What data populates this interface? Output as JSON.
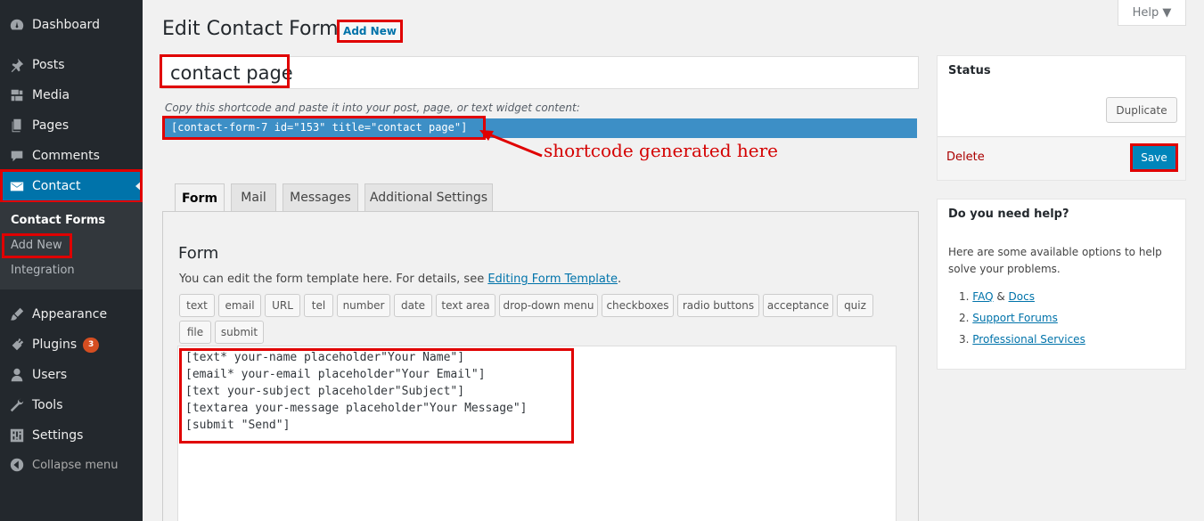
{
  "sidebar": {
    "items": [
      {
        "label": "Dashboard",
        "icon": "dashboard-icon"
      },
      {
        "label": "Posts",
        "icon": "pin-icon"
      },
      {
        "label": "Media",
        "icon": "media-icon"
      },
      {
        "label": "Pages",
        "icon": "pages-icon"
      },
      {
        "label": "Comments",
        "icon": "comment-icon"
      },
      {
        "label": "Contact",
        "icon": "mail-icon"
      },
      {
        "label": "Appearance",
        "icon": "brush-icon"
      },
      {
        "label": "Plugins",
        "icon": "plugin-icon",
        "badge": "3"
      },
      {
        "label": "Users",
        "icon": "users-icon"
      },
      {
        "label": "Tools",
        "icon": "wrench-icon"
      },
      {
        "label": "Settings",
        "icon": "settings-icon"
      }
    ],
    "submenu": [
      "Contact Forms",
      "Add New",
      "Integration"
    ],
    "collapse_label": "Collapse menu"
  },
  "header": {
    "title": "Edit Contact Form",
    "add_new": "Add New",
    "help": "Help ▼"
  },
  "form": {
    "title_value": "contact page",
    "shortcode_hint": "Copy this shortcode and paste it into your post, page, or text widget content:",
    "shortcode": "[contact-form-7 id=\"153\" title=\"contact page\"]",
    "annotation": "shortcode generated here"
  },
  "tabs": [
    "Form",
    "Mail",
    "Messages",
    "Additional Settings"
  ],
  "panel": {
    "title": "Form",
    "desc_prefix": "You can edit the form template here. For details, see ",
    "desc_link": "Editing Form Template",
    "desc_suffix": ".",
    "tag_buttons": [
      "text",
      "email",
      "URL",
      "tel",
      "number",
      "date",
      "text area",
      "drop-down menu",
      "checkboxes",
      "radio buttons",
      "acceptance",
      "quiz",
      "file",
      "submit"
    ],
    "code_lines": [
      "[text* your-name placeholder\"Your Name\"]",
      "[email* your-email placeholder\"Your Email\"]",
      "[text your-subject placeholder\"Subject\"]",
      "[textarea your-message placeholder\"Your Message\"]",
      "[submit \"Send\"]"
    ]
  },
  "status_box": {
    "title": "Status",
    "duplicate": "Duplicate",
    "delete": "Delete",
    "save": "Save"
  },
  "help_box": {
    "title": "Do you need help?",
    "desc": "Here are some available options to help solve your problems.",
    "items": [
      {
        "num": "1.",
        "link1": "FAQ",
        "sep": " & ",
        "link2": "Docs"
      },
      {
        "num": "2.",
        "link1": "Support Forums"
      },
      {
        "num": "3.",
        "link1": "Professional Services"
      }
    ]
  },
  "colors": {
    "sidebar_bg": "#23282d",
    "active_blue": "#0073aa",
    "highlight_red": "#e00000",
    "shortcode_bg": "#3d8fc6"
  }
}
